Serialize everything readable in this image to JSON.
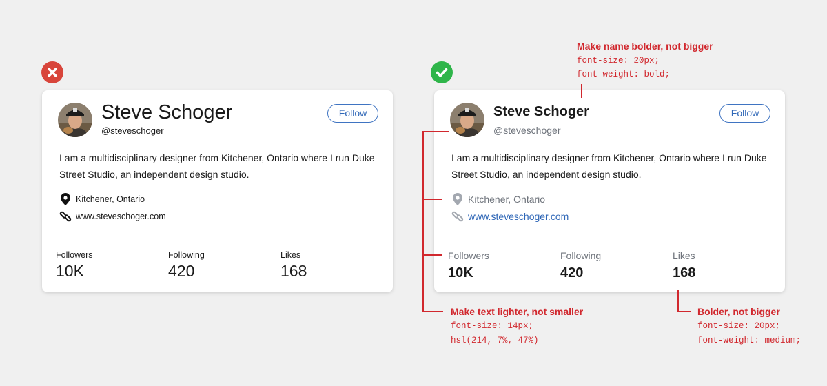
{
  "colors": {
    "bad_badge": "#d8453b",
    "good_badge": "#2fb54a",
    "annotation": "#d1282e",
    "link": "#2f67b7",
    "muted": "#6f747c"
  },
  "bad_card": {
    "name": "Steve Schoger",
    "handle": "@steveschoger",
    "follow_label": "Follow",
    "bio": "I am a multidisciplinary designer from Kitchener, Ontario where I run Duke Street Studio, an independent design studio.",
    "location": "Kitchener, Ontario",
    "website": "www.steveschoger.com",
    "stats": [
      {
        "label": "Followers",
        "value": "10K"
      },
      {
        "label": "Following",
        "value": "420"
      },
      {
        "label": "Likes",
        "value": "168"
      }
    ]
  },
  "good_card": {
    "name": "Steve Schoger",
    "handle": "@steveschoger",
    "follow_label": "Follow",
    "bio": "I am a multidisciplinary designer from Kitchener, Ontario where I run Duke Street Studio, an independent design studio.",
    "location": "Kitchener, Ontario",
    "website": "www.steveschoger.com",
    "stats": [
      {
        "label": "Followers",
        "value": "10K"
      },
      {
        "label": "Following",
        "value": "420"
      },
      {
        "label": "Likes",
        "value": "168"
      }
    ]
  },
  "annotations": {
    "name": {
      "title": "Make name bolder, not bigger",
      "code": [
        "font-size: 20px;",
        "font-weight: bold;"
      ]
    },
    "text": {
      "title": "Make text lighter, not smaller",
      "code": [
        "font-size: 14px;",
        "hsl(214, 7%, 47%)"
      ]
    },
    "stats": {
      "title": "Bolder, not bigger",
      "code": [
        "font-size: 20px;",
        "font-weight: medium;"
      ]
    }
  }
}
